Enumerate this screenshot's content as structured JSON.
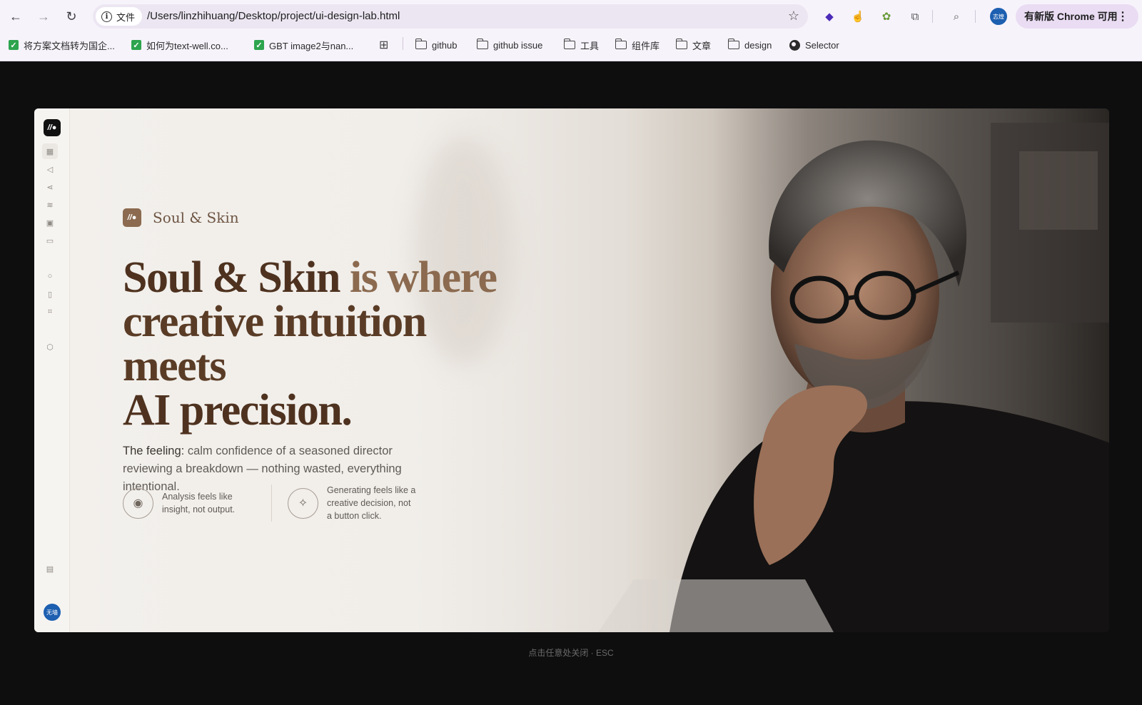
{
  "browser": {
    "site_chip": "文件",
    "url": "/Users/linzhihuang/Desktop/project/ui-design-lab.html",
    "profile_initials": "志煌",
    "update_label": "有新版 Chrome 可用",
    "bookmarks": [
      {
        "label": "将方案文档转为国企...",
        "icon": "check-icon"
      },
      {
        "label": "如何为text-well.co...",
        "icon": "check-icon"
      },
      {
        "label": "GBT image2与nan...",
        "icon": "check-icon"
      },
      {
        "label": "github",
        "icon": "folder-icon"
      },
      {
        "label": "github issue",
        "icon": "folder-icon"
      },
      {
        "label": "工具",
        "icon": "folder-icon"
      },
      {
        "label": "组件库",
        "icon": "folder-icon"
      },
      {
        "label": "文章",
        "icon": "folder-icon"
      },
      {
        "label": "design",
        "icon": "folder-icon"
      },
      {
        "label": "Selector",
        "icon": "globe-icon"
      }
    ]
  },
  "app": {
    "brand_name": "Soul & Skin",
    "headline": {
      "line1_a": "Soul & Skin",
      "line1_b": " is where",
      "line2": "creative intuition meets",
      "line3": "AI precision."
    },
    "subcopy": {
      "lead": "The feeling:",
      "body": " calm confidence of a seasoned director reviewing a breakdown — nothing wasted, everything intentional."
    },
    "features": [
      {
        "icon": "eye-icon",
        "text": "Analysis feels like insight, not output."
      },
      {
        "icon": "sparkle-icon",
        "text": "Generating feels like a creative decision, not a button click."
      }
    ],
    "rail_avatar": "无墙",
    "rail_icons": [
      "grid-icon",
      "megaphone-icon",
      "share-icon",
      "layers-icon",
      "image-icon",
      "calendar-icon",
      "search-icon",
      "book-icon",
      "scan-icon",
      "shield-icon",
      "gift-icon"
    ]
  },
  "overlay": {
    "dismiss_hint": "点击任意处关闭 · ESC"
  },
  "colors": {
    "brand": "#8b6a4f",
    "headline_dark": "#4e321f",
    "page_bg": "#0e0e0f"
  }
}
